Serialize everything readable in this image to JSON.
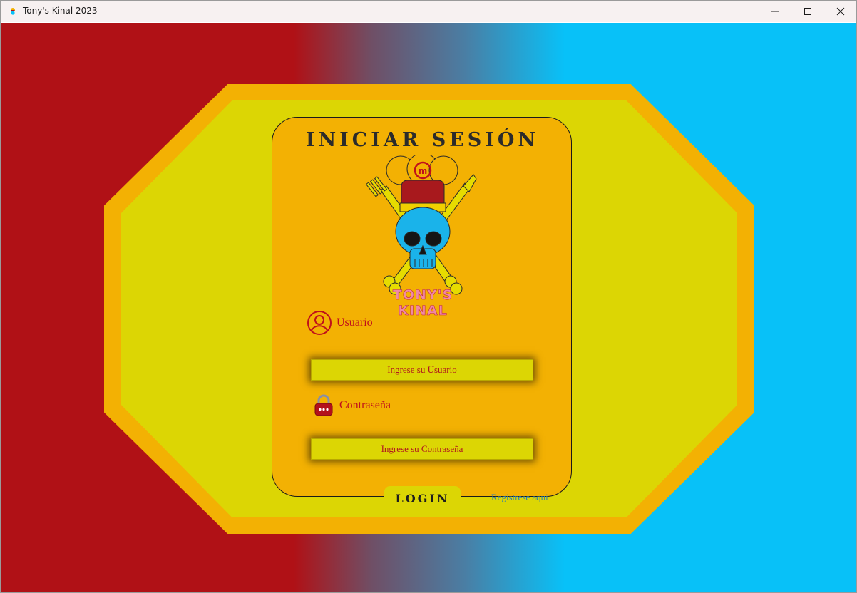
{
  "window": {
    "title": "Tony's Kinal 2023",
    "minimize_icon": "minimize-icon",
    "maximize_icon": "maximize-icon",
    "close_icon": "close-icon"
  },
  "colors": {
    "left_bg": "#b01116",
    "right_bg": "#08c1f8",
    "octagon_outer": "#f3b103",
    "octagon_inner": "#dcd604",
    "card": "#f3b103",
    "label_text": "#c0101b",
    "link": "#2f7fb0"
  },
  "login": {
    "title": "Iniciar Sesión",
    "logo_text": "TONY'S KINAL",
    "user_label": "Usuario",
    "user_icon": "user-icon",
    "user_placeholder": "Ingrese su Usuario",
    "user_value": "",
    "password_label": "Contraseña",
    "password_icon": "lock-icon",
    "password_placeholder": "Ingrese su Contraseña",
    "password_value": "",
    "login_button": "Login",
    "register_link": "Registrese aqui"
  }
}
